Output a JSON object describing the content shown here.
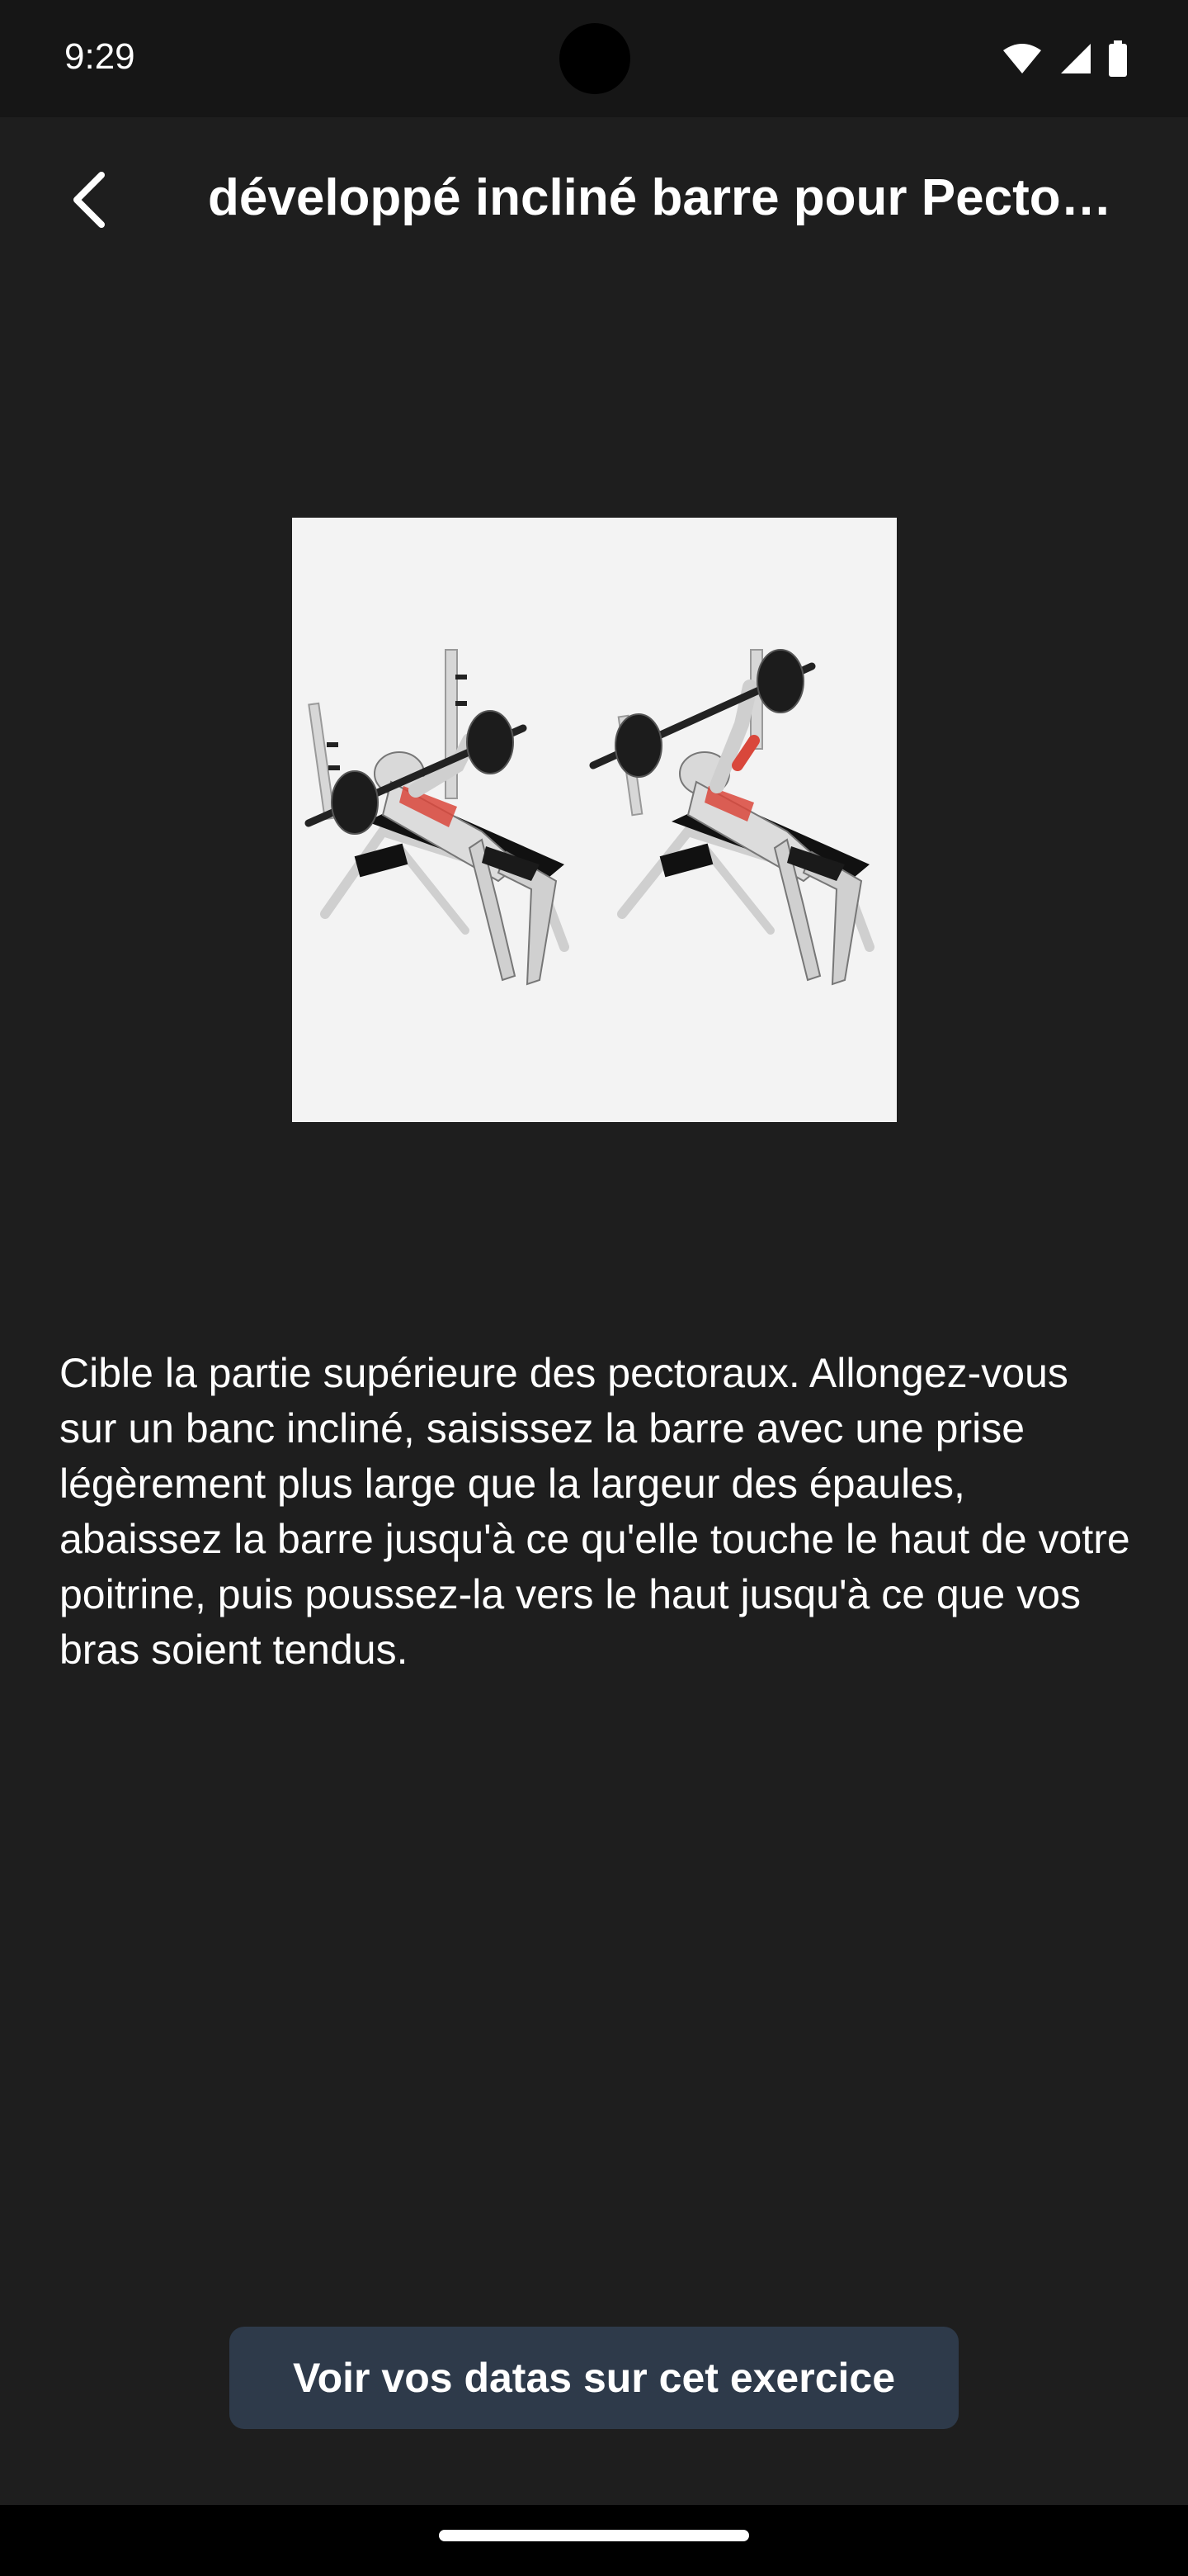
{
  "status_bar": {
    "time": "9:29",
    "icons": [
      "wifi-icon",
      "signal-icon",
      "battery-icon"
    ]
  },
  "header": {
    "back_icon": "back-arrow-icon",
    "title": "développé incliné barre pour Pectoraux"
  },
  "exercise": {
    "image_icon": "incline-barbell-bench-press-illustration",
    "description": "Cible la partie supérieure des pectoraux. Allongez-vous sur un banc incliné, saisissez la barre avec une prise légèrement plus large que la largeur des épaules, abaissez la barre jusqu'à ce qu'elle touche le haut de votre poitrine, puis poussez-la vers le haut jusqu'à ce que vos bras soient tendus."
  },
  "actions": {
    "view_data_label": "Voir vos datas sur cet exercice"
  },
  "colors": {
    "background": "#1e1e1e",
    "status_bar": "#161616",
    "button": "#2e3a4a",
    "text": "#ffffff",
    "muscle_highlight": "#d9473b"
  }
}
